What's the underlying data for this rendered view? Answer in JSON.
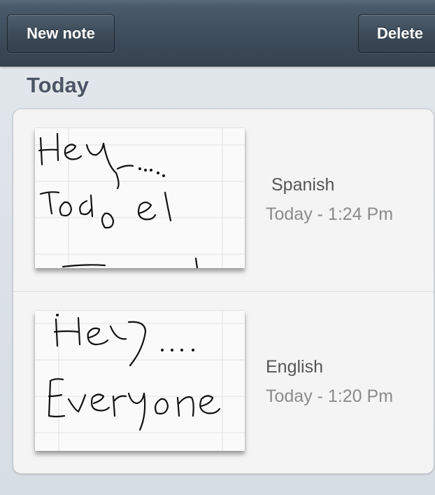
{
  "toolbar": {
    "new_note_label": "New note",
    "delete_label": "Delete"
  },
  "section": {
    "title": "Today"
  },
  "notes": [
    {
      "title": "Spanish",
      "time": "Today - 1:24 Pm",
      "handwriting_lines": [
        "Hey.....",
        "Todo el"
      ]
    },
    {
      "title": "English",
      "time": "Today - 1:20 Pm",
      "handwriting_lines": [
        "Hey.....",
        "Everyone"
      ]
    }
  ]
}
